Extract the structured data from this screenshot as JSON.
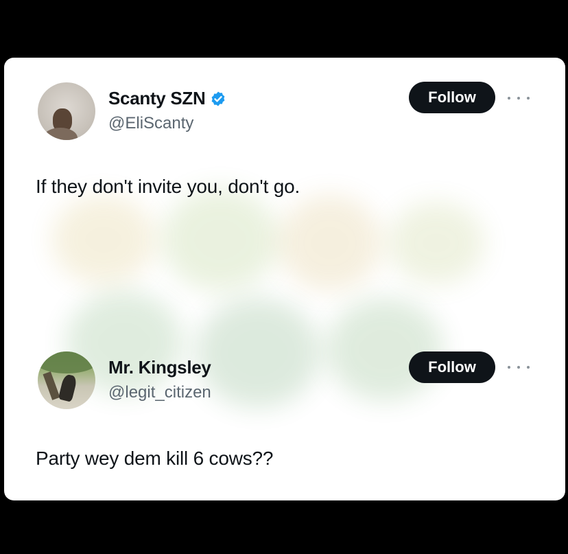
{
  "tweets": [
    {
      "display_name": "Scanty SZN",
      "handle": "@EliScanty",
      "verified": true,
      "follow_label": "Follow",
      "text": "If they don't invite you, don't go."
    },
    {
      "display_name": "Mr. Kingsley",
      "handle": "@legit_citizen",
      "verified": false,
      "follow_label": "Follow",
      "text": "Party wey dem kill 6 cows??"
    }
  ],
  "icons": {
    "verified": "verified-badge-icon",
    "more": "more-options-icon"
  },
  "colors": {
    "background": "#000000",
    "card": "#ffffff",
    "button": "#0f1419",
    "verified": "#1d9bf0",
    "handle": "#5b6670"
  }
}
